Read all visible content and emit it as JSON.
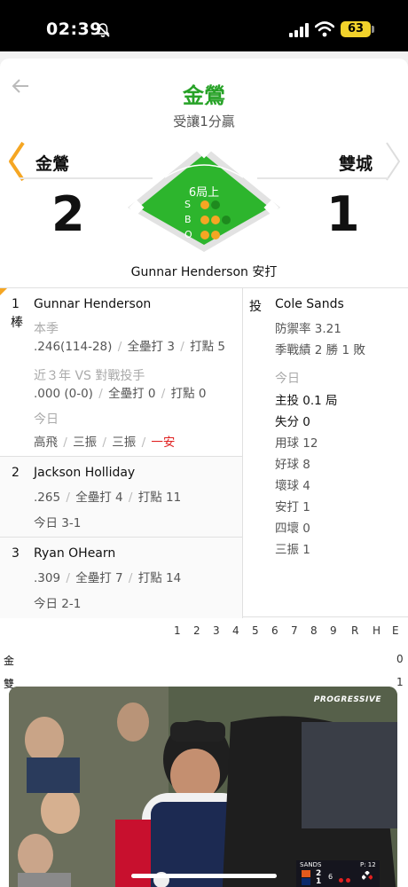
{
  "status_bar": {
    "time": "02:39",
    "battery": "63",
    "icons": [
      "bell-off-icon",
      "signal-icon",
      "wifi-icon",
      "battery-icon"
    ]
  },
  "header": {
    "title": "金鶯",
    "subtitle": "受讓1分贏",
    "back_icon": "back-arrow-icon"
  },
  "scoreboard": {
    "away_team": "金鶯",
    "home_team": "雙城",
    "away_score": "2",
    "home_score": "1",
    "inning": "6局上",
    "count": {
      "balls_label": "B",
      "strikes_label": "S",
      "outs_label": "O",
      "strikes": 1,
      "balls": 2,
      "outs": 2
    },
    "last_play": "Gunnar Henderson 安打",
    "colors": {
      "field": "#2db52d",
      "accent": "#27a227",
      "count_on": "#f5a623"
    }
  },
  "batters": [
    {
      "order": "1",
      "tag": "棒",
      "name": "Gunnar Henderson",
      "season_label": "本季",
      "season_avg": ".246(114-28)",
      "season_hr": "全壘打 3",
      "season_rbi": "打點 5",
      "vs_label": "近３年 VS 對戰投手",
      "vs_avg": ".000 (0-0)",
      "vs_hr": "全壘打 0",
      "vs_rbi": "打點 0",
      "today_label": "今日",
      "today_results": [
        "高飛",
        "三振",
        "三振"
      ],
      "today_hit": "一安"
    },
    {
      "order": "2",
      "name": "Jackson Holliday",
      "avg": ".265",
      "hr": "全壘打 4",
      "rbi": "打點 11",
      "today": "今日 3-1"
    },
    {
      "order": "3",
      "name": "Ryan OHearn",
      "avg": ".309",
      "hr": "全壘打 7",
      "rbi": "打點 14",
      "today": "今日 2-1"
    }
  ],
  "pitcher": {
    "tag": "投",
    "name": "Cole Sands",
    "era": "防禦率 3.21",
    "record": "季戰績 2 勝 1 敗",
    "today_label": "今日",
    "innings": "主投 0.1 局",
    "runs": "失分 0",
    "pitches": "用球 12",
    "strikes": "好球 8",
    "balls": "壞球 4",
    "hits": "安打 1",
    "walks": "四壞 0",
    "strikeouts": "三振 1"
  },
  "linescore": {
    "innings_header": [
      "1",
      "2",
      "3",
      "4",
      "5",
      "6",
      "7",
      "8",
      "9",
      "R",
      "H",
      "E"
    ],
    "rows": [
      "金",
      "雙"
    ],
    "row_end_values": [
      "0",
      "1"
    ]
  },
  "video": {
    "sponsor": "PROGRESSIVE",
    "mini_score": {
      "pitcher": "SANDS",
      "pitch_count": "P: 12",
      "away_runs": "2",
      "home_runs": "1",
      "inning": "6"
    }
  }
}
